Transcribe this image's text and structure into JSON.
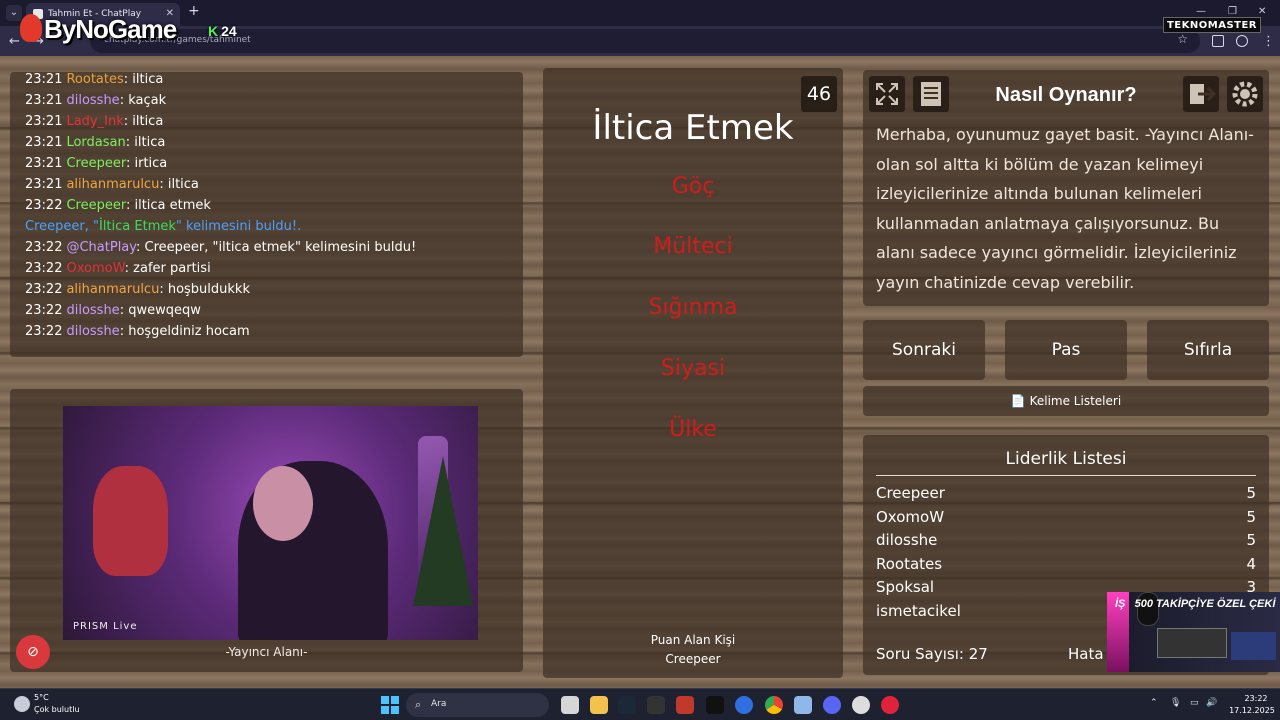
{
  "browser": {
    "tab_title": "Tahmin Et - ChatPlay",
    "url": "chatplay.com.tr/games/tahminet",
    "tab_close": "✕",
    "new_tab": "+",
    "tab_list": "⌄"
  },
  "overlay": {
    "brand": "ByNoGame",
    "kick_count": "24",
    "kick_letter": "K",
    "sponsor": "TEKNOMASTER"
  },
  "chat": {
    "messages": [
      {
        "time": "23:21",
        "user": "Rootates",
        "color": "#e8a23a",
        "text": "iltica"
      },
      {
        "time": "23:21",
        "user": "dilosshe",
        "color": "#c79bff",
        "text": "kaçak"
      },
      {
        "time": "23:21",
        "user": "Lady_Ink",
        "color": "#e0323c",
        "text": "iltica"
      },
      {
        "time": "23:21",
        "user": "Lordasan",
        "color": "#7cf05c",
        "text": "iltica"
      },
      {
        "time": "23:21",
        "user": "Creepeer",
        "color": "#7cf05c",
        "text": "irtica"
      },
      {
        "time": "23:21",
        "user": "alihanmarulcu",
        "color": "#f0a542",
        "text": "iltica"
      },
      {
        "time": "23:22",
        "user": "Creepeer",
        "color": "#7cf05c",
        "text": "iltica etmek"
      },
      {
        "system": true,
        "text_prefix": "Creepeer, \"",
        "highlight": "İltica Etmek",
        "text_suffix": "\" kelimesini buldu!."
      },
      {
        "time": "23:22",
        "user": "@ChatPlay",
        "color": "#c79bff",
        "text": "Creepeer, \"iltica etmek\" kelimesini buldu!"
      },
      {
        "time": "23:22",
        "user": "OxomoW",
        "color": "#e0323c",
        "text": "zafer partisi"
      },
      {
        "time": "23:22",
        "user": "alihanmarulcu",
        "color": "#f0a542",
        "text": "hoşbuldukkk"
      },
      {
        "time": "23:22",
        "user": "dilosshe",
        "color": "#c79bff",
        "text": "qwewqeqw"
      },
      {
        "time": "23:22",
        "user": "dilosshe",
        "color": "#c79bff",
        "text": "hoşgeldiniz hocam"
      }
    ]
  },
  "stream": {
    "caption": "-Yayıncı Alanı-",
    "prism": "PRISM Live"
  },
  "game": {
    "word": "İltica Etmek",
    "counter": "46",
    "forbidden": [
      "Göç",
      "Mülteci",
      "Sığınma",
      "Siyasi",
      "Ülke"
    ],
    "scorer_label": "Puan Alan Kişi",
    "scorer_name": "Creepeer"
  },
  "howto": {
    "title": "Nasıl Oynanır?",
    "text": "Merhaba, oyunumuz gayet basit. -Yayıncı Alanı- olan sol altta ki bölüm de yazan kelimeyi izleyicilerinize altında bulunan kelimeleri kullanmadan anlatmaya çalışıyorsunuz. Bu alanı sadece yayıncı görmelidir. İzleyicileriniz yayın chatinizde cevap verebilir."
  },
  "actions": {
    "next": "Sonraki",
    "pass": "Pas",
    "reset": "Sıfırla",
    "word_lists": "📄 Kelime Listeleri"
  },
  "leaderboard": {
    "title": "Liderlik Listesi",
    "rows": [
      {
        "name": "Creepeer",
        "score": "5"
      },
      {
        "name": "OxomoW",
        "score": "5"
      },
      {
        "name": "dilosshe",
        "score": "5"
      },
      {
        "name": "Rootates",
        "score": "4"
      },
      {
        "name": "Spoksal",
        "score": "3"
      },
      {
        "name": "ismetacikel",
        "score": ""
      }
    ],
    "question_count": "Soru Sayısı: 27",
    "error_label": "Hata S"
  },
  "promo": {
    "headline": "500 TAKİPÇİYE ÖZEL ÇEKİ",
    "prefix": "İŞ"
  },
  "taskbar": {
    "temp": "5°C",
    "weather": "Çok bulutlu",
    "search_placeholder": "Ara",
    "time": "23:22",
    "date": "17.12.2025"
  },
  "colors": {
    "forbidden": "#d11c1c",
    "system_msg": "#4aa0ff",
    "highlight": "#3ddc5c"
  }
}
